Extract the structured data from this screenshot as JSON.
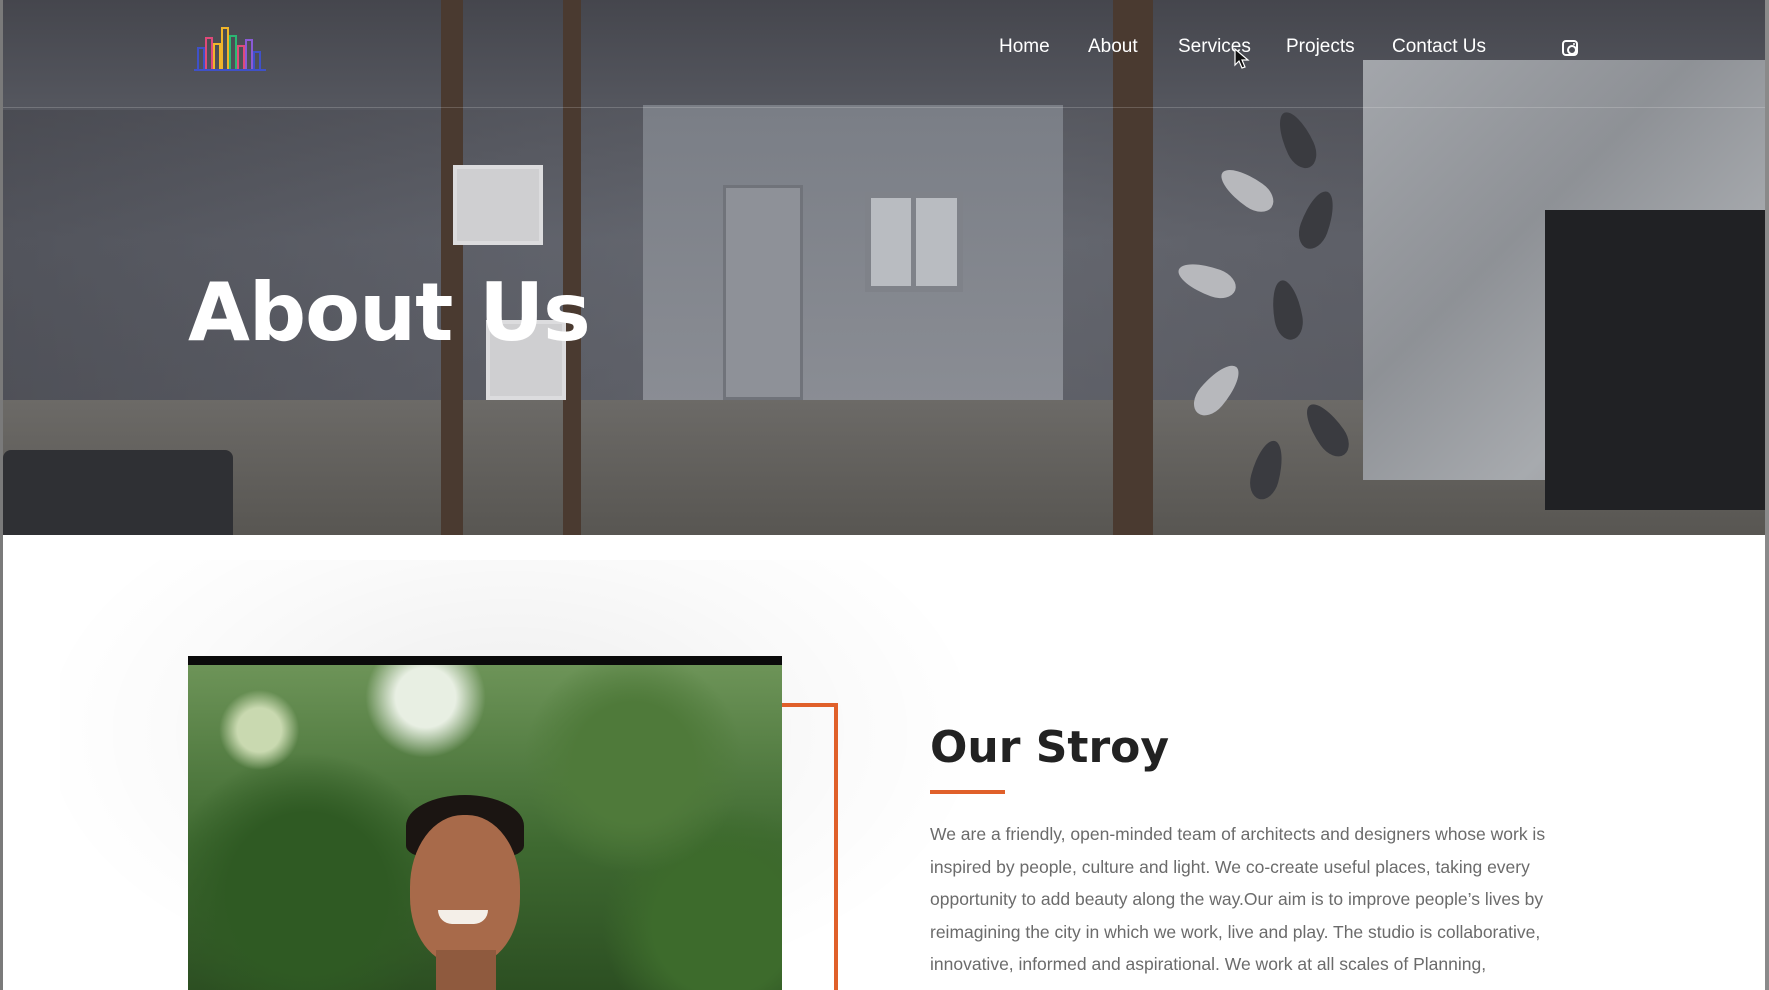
{
  "nav": {
    "items": [
      {
        "label": "Home"
      },
      {
        "label": "About"
      },
      {
        "label": "Services"
      },
      {
        "label": "Projects"
      },
      {
        "label": "Contact Us"
      }
    ],
    "social_icon": "instagram-icon"
  },
  "hero": {
    "title": "About Us"
  },
  "story": {
    "title": "Our Stroy",
    "body": "We are a friendly, open-minded team of architects and designers whose work is inspired by people, culture and light. We co-create useful places, taking every opportunity to add beauty along the way.Our aim is to improve people’s lives by reimagining the city in which we work, live and play. The studio is collaborative, innovative, informed and aspirational. We work at all scales of Planning,"
  },
  "colors": {
    "accent": "#e0602a",
    "heading": "#222222",
    "body_text": "#6b6b6b"
  }
}
